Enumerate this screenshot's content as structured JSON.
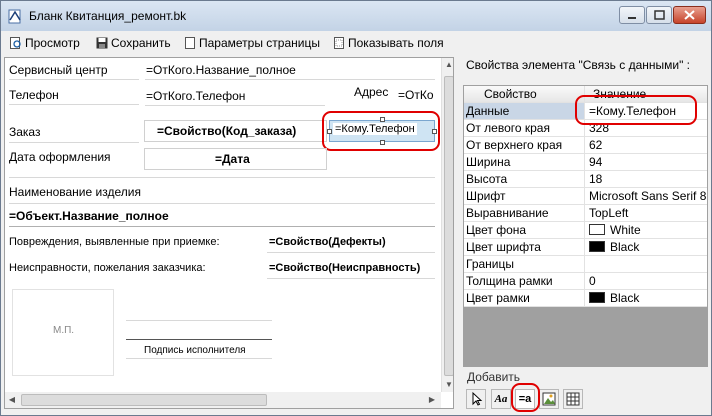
{
  "window": {
    "title": "Бланк  Квитанция_ремонт.bk"
  },
  "toolbar": {
    "preview_label": "Просмотр",
    "save_label": "Сохранить",
    "page_params_label": "Параметры страницы",
    "show_fields_label": "Показывать поля"
  },
  "form": {
    "service_center_label": "Сервисный центр",
    "service_center_value": "=ОтКого.Название_полное",
    "phone_label": "Телефон",
    "phone_value": "=ОтКого.Телефон",
    "address_label": "Адрес",
    "address_value": "=ОтКо",
    "order_label": "Заказ",
    "order_value": "=Свойство(Код_заказа)",
    "selected_field_value": "=Кому.Телефон",
    "date_label": "Дата оформления",
    "date_value": "=Дата",
    "product_name_label": "Наименование изделия",
    "product_name_value": "=Объект.Название_полное",
    "damage_label": "Повреждения, выявленные при приемке:",
    "damage_value": "=Свойство(Дефекты)",
    "faults_label": "Неисправности, пожелания заказчика:",
    "faults_value": "=Свойство(Неисправность)",
    "stamp_label": "М.П.",
    "signature_label": "Подпись исполнителя"
  },
  "properties": {
    "title": "Свойства элемента \"Связь с данными\" :",
    "col_property": "Свойство",
    "col_value": "Значение",
    "rows": [
      {
        "name": "Данные",
        "value": "=Кому.Телефон"
      },
      {
        "name": "От левого края",
        "value": "328"
      },
      {
        "name": "От верхнего края",
        "value": "62"
      },
      {
        "name": "Ширина",
        "value": "94"
      },
      {
        "name": "Высота",
        "value": "18"
      },
      {
        "name": "Шрифт",
        "value": "Microsoft Sans Serif 8"
      },
      {
        "name": "Выравнивание",
        "value": "TopLeft"
      },
      {
        "name": "Цвет фона",
        "value": "White",
        "swatch": "#ffffff"
      },
      {
        "name": "Цвет шрифта",
        "value": "Black",
        "swatch": "#000000"
      },
      {
        "name": "Границы",
        "value": ""
      },
      {
        "name": "Толщина рамки",
        "value": "0"
      },
      {
        "name": "Цвет рамки",
        "value": "Black",
        "swatch": "#000000"
      }
    ]
  },
  "add_panel": {
    "label": "Добавить",
    "tools": [
      "pointer-icon",
      "text-tool-icon",
      "data-link-tool-icon",
      "image-tool-icon",
      "table-tool-icon"
    ],
    "text_tool_glyph": "Aa",
    "data_link_glyph": "=a"
  },
  "colors": {
    "highlight": "#e00000",
    "selected_field_bg": "#cfe4f3"
  }
}
